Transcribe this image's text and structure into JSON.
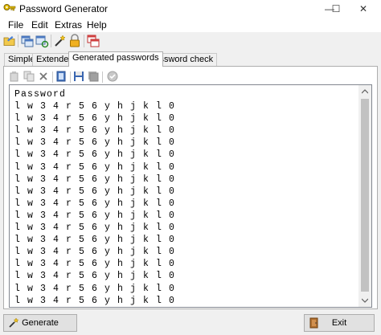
{
  "window": {
    "title": "Password Generator",
    "controls": {
      "minimize": "—",
      "maximize": "☐",
      "close": "✕"
    }
  },
  "menu": {
    "items": [
      "File",
      "Edit",
      "Extras",
      "Help"
    ]
  },
  "toolbar": {
    "icons": [
      "open-folder-icon",
      "copy-window-icon",
      "window-refresh-icon",
      "wizard-icon",
      "lock-icon",
      "window-stack-icon"
    ]
  },
  "tabs": [
    {
      "label": "Simple",
      "active": false
    },
    {
      "label": "Extended",
      "active": false
    },
    {
      "label": "Generated passwords",
      "active": true
    },
    {
      "label": "Password check",
      "active": false
    }
  ],
  "inner_toolbar": {
    "icons": [
      "paste-icon",
      "copy-icon",
      "delete-icon",
      "document-icon",
      "save-icon",
      "save-all-icon",
      "check-icon"
    ]
  },
  "list": {
    "header": "Password",
    "rows": [
      "lw34r56yhjkl0",
      "lw34r56yhjkl0",
      "lw34r56yhjkl0",
      "lw34r56yhjkl0",
      "lw34r56yhjkl0",
      "lw34r56yhjkl0",
      "lw34r56yhjkl0",
      "lw34r56yhjkl0",
      "lw34r56yhjkl0",
      "lw34r56yhjkl0",
      "lw34r56yhjkl0",
      "lw34r56yhjkl0",
      "lw34r56yhjkl0",
      "lw34r56yhjkl0",
      "lw34r56yhjkl0",
      "lw34r56yhjkl0",
      "lw34r56yhjkl0"
    ]
  },
  "buttons": {
    "generate": "Generate",
    "exit": "Exit"
  }
}
